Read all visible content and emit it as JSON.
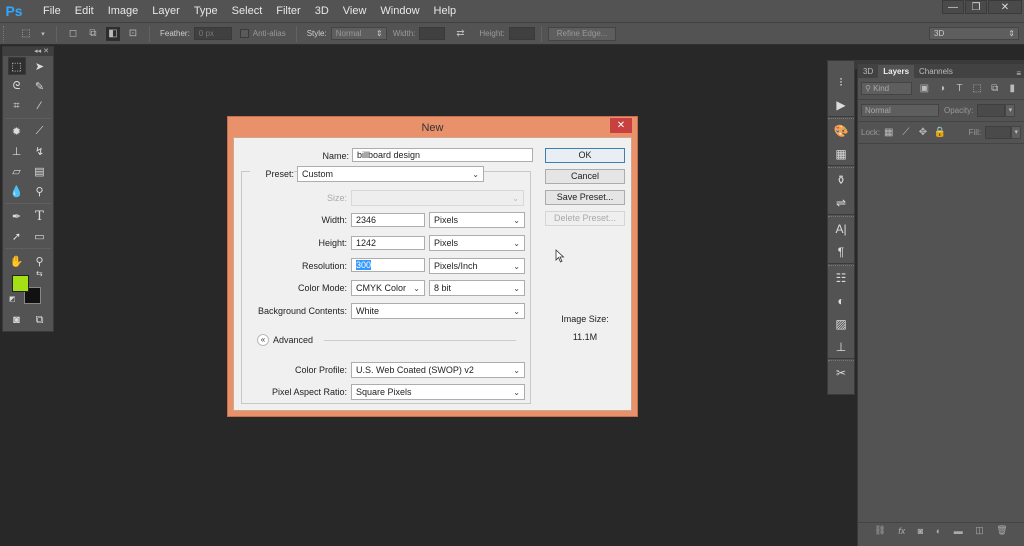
{
  "app": {
    "logo": "Ps",
    "menu": [
      "File",
      "Edit",
      "Image",
      "Layer",
      "Type",
      "Select",
      "Filter",
      "3D",
      "View",
      "Window",
      "Help"
    ],
    "window_controls": {
      "minimize": "—",
      "restore": "❐",
      "close": "✕"
    }
  },
  "options_bar": {
    "feather_label": "Feather:",
    "feather_value": "0 px",
    "antialias_label": "Anti-alias",
    "style_label": "Style:",
    "style_value": "Normal",
    "width_label": "Width:",
    "width_value": "",
    "height_label": "Height:",
    "height_value": "",
    "refine_edge_label": "Refine Edge...",
    "workspace_value": "3D"
  },
  "tools": {
    "foreground_color": "#a5e015",
    "background_color": "#111111"
  },
  "layers_panel": {
    "tabs": [
      "3D",
      "Layers",
      "Channels"
    ],
    "active_tab": "Layers",
    "filter_kind": "Kind",
    "blend_mode": "Normal",
    "opacity_label": "Opacity:",
    "opacity_value": "",
    "lock_label": "Lock:",
    "fill_label": "Fill:",
    "fill_value": ""
  },
  "dialog": {
    "title": "New",
    "close": "✕",
    "name_label": "Name:",
    "name_value": "billboard design",
    "preset_label": "Preset:",
    "preset_value": "Custom",
    "size_label": "Size:",
    "size_value": "",
    "width_label": "Width:",
    "width_value": "2346",
    "width_unit": "Pixels",
    "height_label": "Height:",
    "height_value": "1242",
    "height_unit": "Pixels",
    "resolution_label": "Resolution:",
    "resolution_value": "300",
    "resolution_unit": "Pixels/Inch",
    "color_mode_label": "Color Mode:",
    "color_mode_value": "CMYK Color",
    "bit_depth_value": "8 bit",
    "background_label": "Background Contents:",
    "background_value": "White",
    "advanced_label": "Advanced",
    "color_profile_label": "Color Profile:",
    "color_profile_value": "U.S. Web Coated (SWOP) v2",
    "pixel_aspect_label": "Pixel Aspect Ratio:",
    "pixel_aspect_value": "Square Pixels",
    "buttons": {
      "ok": "OK",
      "cancel": "Cancel",
      "save_preset": "Save Preset...",
      "delete_preset": "Delete Preset..."
    },
    "image_size_label": "Image Size:",
    "image_size_value": "11.1M"
  }
}
